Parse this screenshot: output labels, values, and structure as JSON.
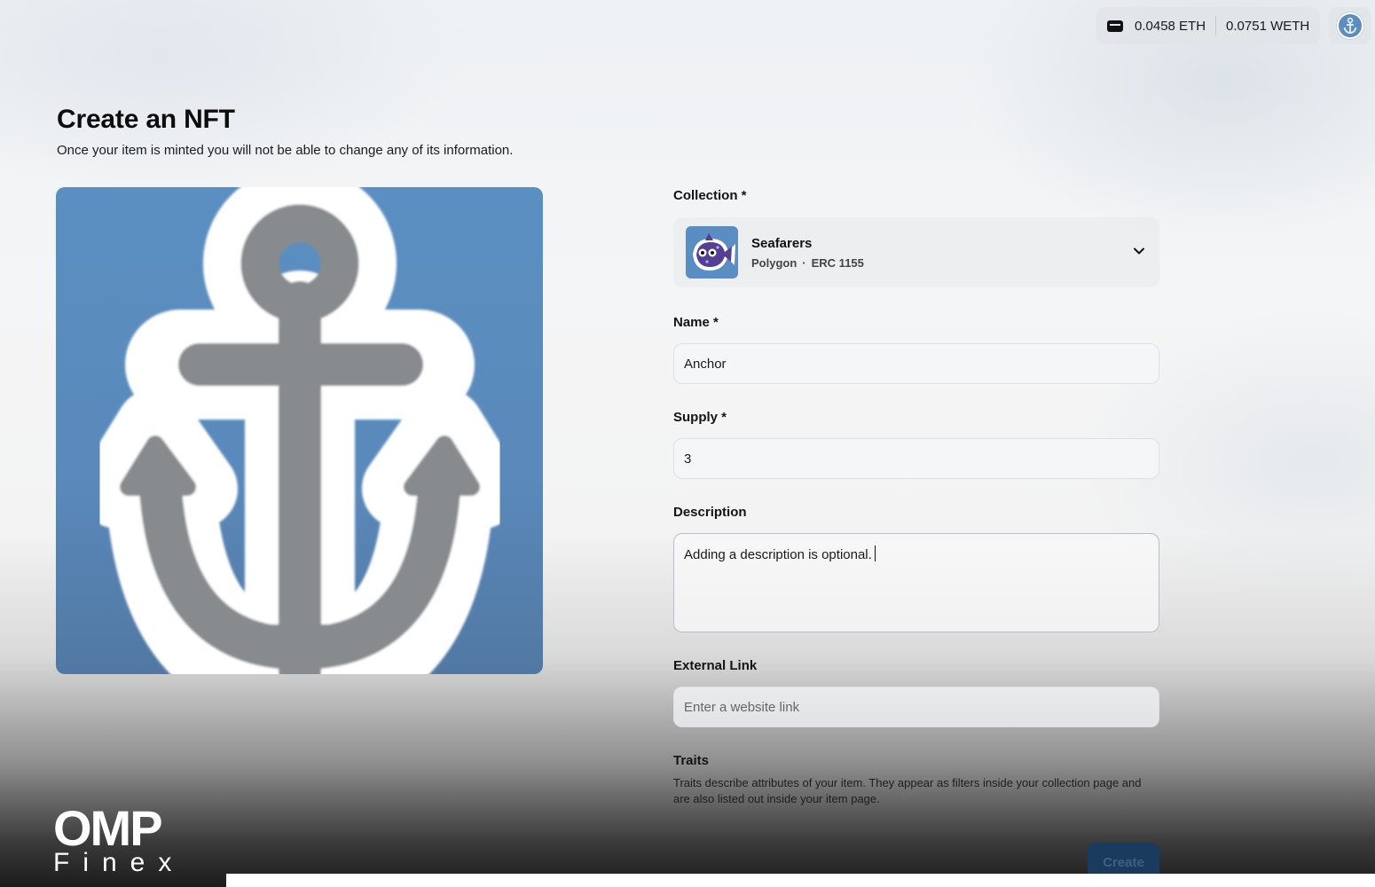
{
  "wallet": {
    "eth": "0.0458 ETH",
    "weth": "0.0751 WETH"
  },
  "page": {
    "title": "Create an NFT",
    "subtitle": "Once your item is minted you will not be able to change any of its information."
  },
  "form": {
    "collection": {
      "label": "Collection *",
      "name": "Seafarers",
      "network": "Polygon",
      "separator": "·",
      "standard": "ERC 1155"
    },
    "name": {
      "label": "Name *",
      "value": "Anchor"
    },
    "supply": {
      "label": "Supply *",
      "value": "3"
    },
    "description": {
      "label": "Description",
      "value": "Adding a description is optional."
    },
    "external_link": {
      "label": "External Link",
      "placeholder": "Enter a website link"
    },
    "traits": {
      "label": "Traits",
      "description": "Traits describe attributes of your item. They appear as filters inside your collection page and are also listed out inside your item page."
    },
    "create_label": "Create"
  },
  "watermark": {
    "line1": "OMP",
    "line2": "Finex"
  },
  "colors": {
    "preview_bg": "#5b8fc1",
    "anchor": "#878b8e",
    "create_button": "#1a3a5e"
  },
  "icons": {
    "wallet": "wallet-icon",
    "avatar": "anchor-avatar-icon",
    "chevron": "chevron-down-icon",
    "collection_thumb": "fish-icon",
    "preview": "anchor-icon"
  }
}
